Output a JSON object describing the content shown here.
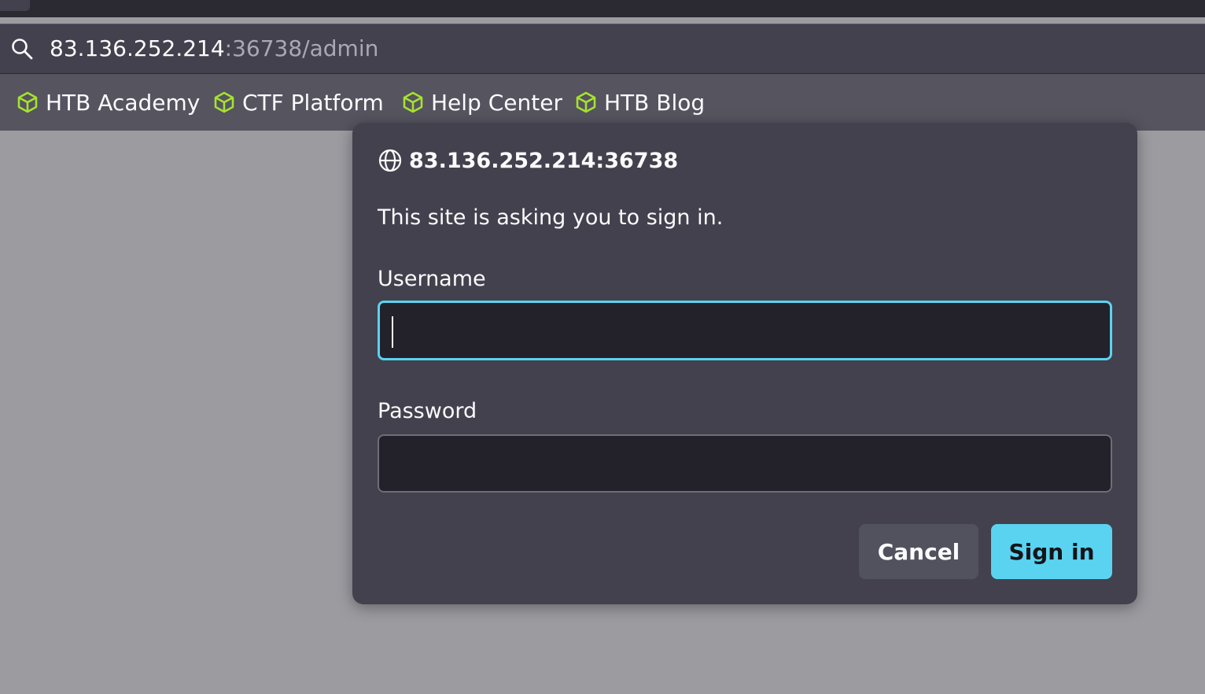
{
  "browser": {
    "url_host": "83.136.252.214",
    "url_rest": ":36738/admin",
    "bookmarks": [
      {
        "label": "HTB Academy",
        "icon": "cube-icon"
      },
      {
        "label": "CTF Platform",
        "icon": "cube-icon"
      },
      {
        "label": "Help Center",
        "icon": "cube-icon"
      },
      {
        "label": "HTB Blog",
        "icon": "cube-icon"
      }
    ]
  },
  "dialog": {
    "origin": "83.136.252.214:36738",
    "message": "This site is asking you to sign in.",
    "username_label": "Username",
    "username_value": "",
    "password_label": "Password",
    "password_value": "",
    "cancel_label": "Cancel",
    "signin_label": "Sign in"
  },
  "colors": {
    "accent": "#5ad3f0",
    "bookmark_icon": "#a6e22e",
    "dialog_bg": "#42414d",
    "field_bg": "#23222b"
  }
}
